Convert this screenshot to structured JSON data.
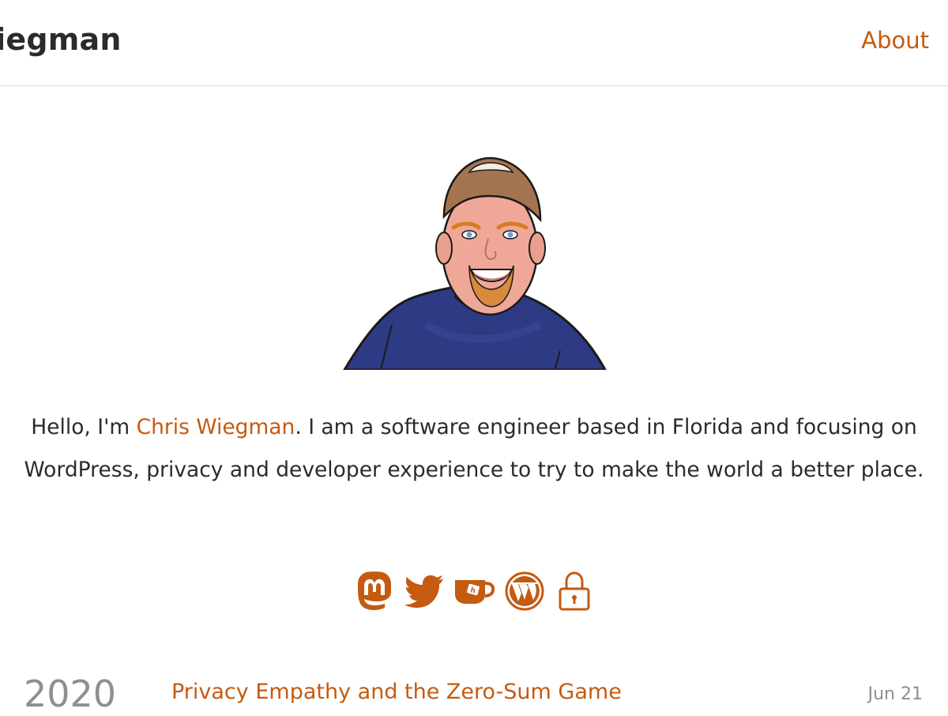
{
  "header": {
    "site_title": "Wiegman",
    "nav_about": "About"
  },
  "intro": {
    "prefix": "Hello, I'm ",
    "name_link": "Chris Wiegman",
    "suffix": ". I am a software engineer based in Florida and focusing on WordPress, privacy and developer experience to try to make the world a better place."
  },
  "socials": [
    {
      "icon": "mastodon-icon"
    },
    {
      "icon": "twitter-icon"
    },
    {
      "icon": "ko-fi-icon"
    },
    {
      "icon": "wordpress-icon"
    },
    {
      "icon": "lock-icon"
    }
  ],
  "posts": {
    "year": "2020",
    "items": [
      {
        "title": "Privacy Empathy and the Zero-Sum Game",
        "date": "Jun 21"
      }
    ]
  },
  "colors": {
    "accent": "#c55a11",
    "text": "#2b2b2b",
    "muted": "#8f8f8f"
  }
}
